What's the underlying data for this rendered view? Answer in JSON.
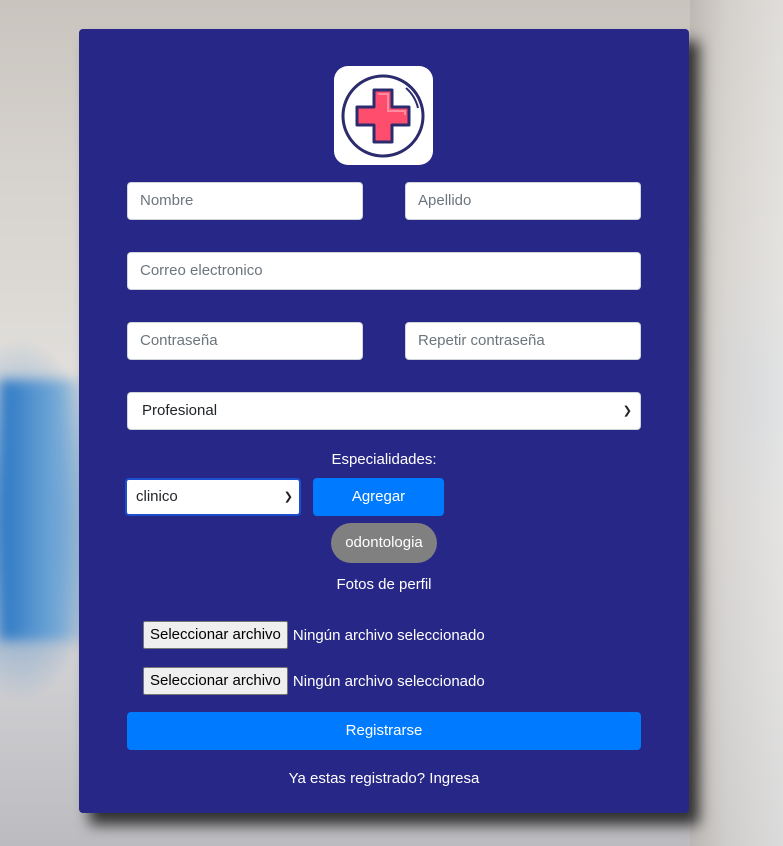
{
  "form": {
    "nombre_placeholder": "Nombre",
    "apellido_placeholder": "Apellido",
    "correo_placeholder": "Correo electronico",
    "contrasena_placeholder": "Contraseña",
    "repetir_placeholder": "Repetir contraseña",
    "tipo_selected": "Profesional",
    "especialidades_label": "Especialidades:",
    "especialidad_selected": "clinico",
    "agregar_label": "Agregar",
    "especialidad_chip": "odontologia",
    "fotos_label": "Fotos de perfil",
    "file_button_label": "Seleccionar archivo",
    "file_status": "Ningún archivo seleccionado",
    "registrarse_label": "Registrarse",
    "login_text": "Ya estas registrado? Ingresa"
  },
  "colors": {
    "card_bg": "#272787",
    "primary": "#007bff",
    "chip": "#808080",
    "logo_cross": "#ff4d6d"
  },
  "icons": {
    "logo": "medical-cross-icon",
    "select_arrow": "chevron-down-icon"
  }
}
